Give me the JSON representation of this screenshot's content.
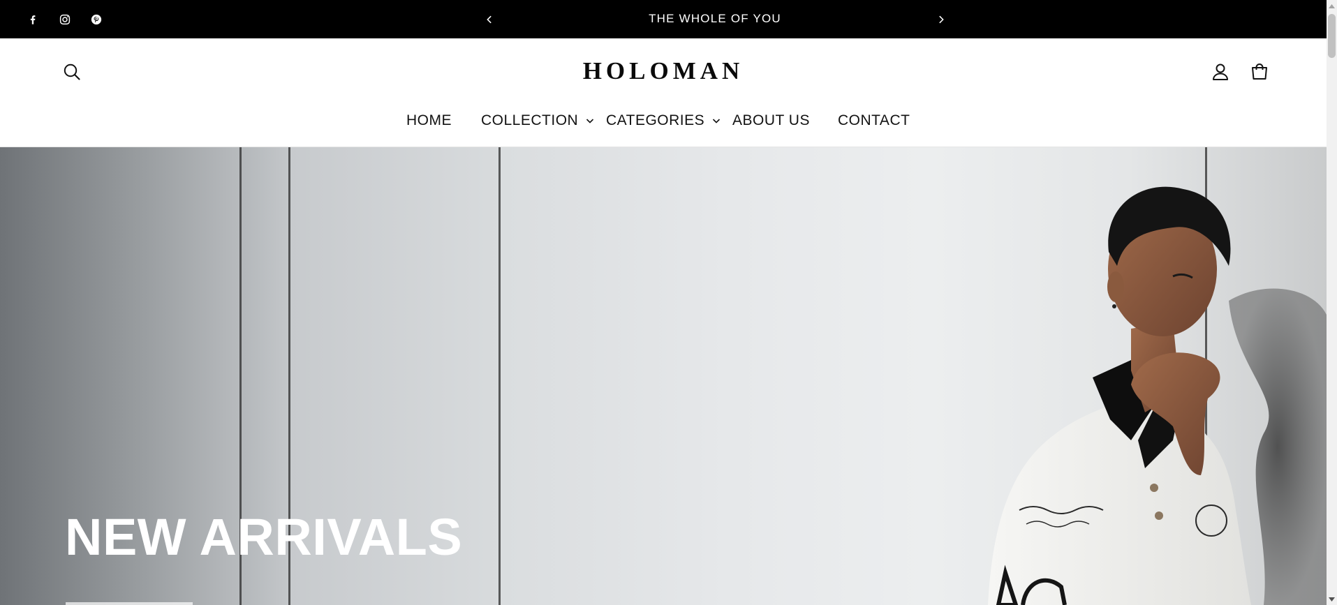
{
  "announcement": {
    "text": "THE WHOLE OF YOU",
    "social_icons": [
      "facebook-icon",
      "instagram-icon",
      "pinterest-icon"
    ],
    "prev_icon": "chevron-left-icon",
    "next_icon": "chevron-right-icon"
  },
  "header": {
    "logo": "HOLOMAN",
    "search_icon": "search-icon",
    "account_icon": "account-icon",
    "cart_icon": "cart-icon"
  },
  "nav": {
    "items": [
      {
        "label": "HOME",
        "has_dropdown": false
      },
      {
        "label": "COLLECTION",
        "has_dropdown": true
      },
      {
        "label": "CATEGORIES",
        "has_dropdown": true
      },
      {
        "label": "ABOUT US",
        "has_dropdown": false
      },
      {
        "label": "CONTACT",
        "has_dropdown": false
      }
    ]
  },
  "hero": {
    "title": "NEW ARRIVALS"
  },
  "colors": {
    "announcement_bg": "#000000",
    "header_bg": "#ffffff",
    "text": "#121212",
    "hero_text": "#ffffff"
  }
}
